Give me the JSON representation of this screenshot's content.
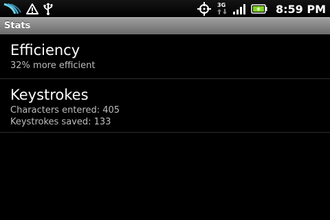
{
  "status_bar": {
    "left_icons": [
      "htc-sense-icon",
      "warning-icon",
      "usb-icon"
    ],
    "right_icons": [
      "gps-icon",
      "3g-data-icon",
      "signal-icon",
      "battery-charging-icon"
    ],
    "network_label": "3G",
    "time": "8:59 PM"
  },
  "title_bar": {
    "title": "Stats"
  },
  "items": [
    {
      "title": "Efficiency",
      "lines": [
        "32% more efficient"
      ]
    },
    {
      "title": "Keystrokes",
      "lines": [
        "Characters entered: 405",
        "Keystrokes saved: 133"
      ]
    }
  ],
  "colors": {
    "background": "#000000",
    "title_bar": "#8a8a8a",
    "primary_text": "#ffffff",
    "secondary_text": "#bdbdbd",
    "battery": "#7ed321"
  }
}
